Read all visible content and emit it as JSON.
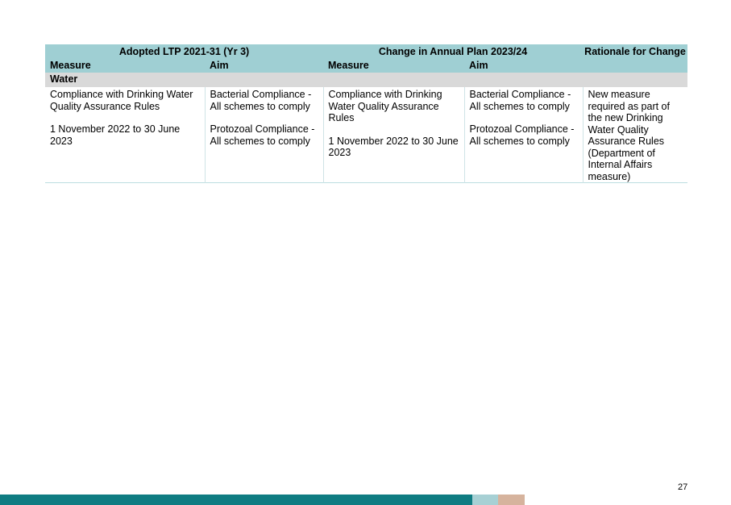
{
  "table": {
    "header_groups": {
      "adopted": "Adopted LTP 2021-31 (Yr 3)",
      "change": "Change in Annual Plan 2023/24",
      "rationale": "Rationale for Change"
    },
    "subheaders": {
      "measure1": "Measure",
      "aim1": "Aim",
      "measure2": "Measure",
      "aim2": "Aim"
    },
    "section": "Water",
    "row": {
      "adopted_measure": [
        "Compliance with Drinking Water Quality Assurance Rules",
        "1 November 2022 to 30 June 2023"
      ],
      "adopted_aim": [
        "Bacterial Compliance - All schemes to comply",
        "Protozoal Compliance - All schemes to comply"
      ],
      "change_measure": [
        "Compliance with Drinking Water Quality Assurance Rules",
        "1 November 2022 to 30 June 2023"
      ],
      "change_aim": [
        "Bacterial Compliance - All schemes to comply",
        "Protozoal Compliance - All schemes to comply"
      ],
      "rationale": "New measure required as part of the new Drinking Water Quality Assurance Rules (Department of Internal Affairs measure)"
    }
  },
  "page_number": "27",
  "colors": {
    "header_bg": "#9fcfd3",
    "section_bg": "#d9d9d9",
    "footer_teal": "#0f7c82",
    "footer_light": "#a7d0d4",
    "footer_tan": "#d6b39d"
  }
}
